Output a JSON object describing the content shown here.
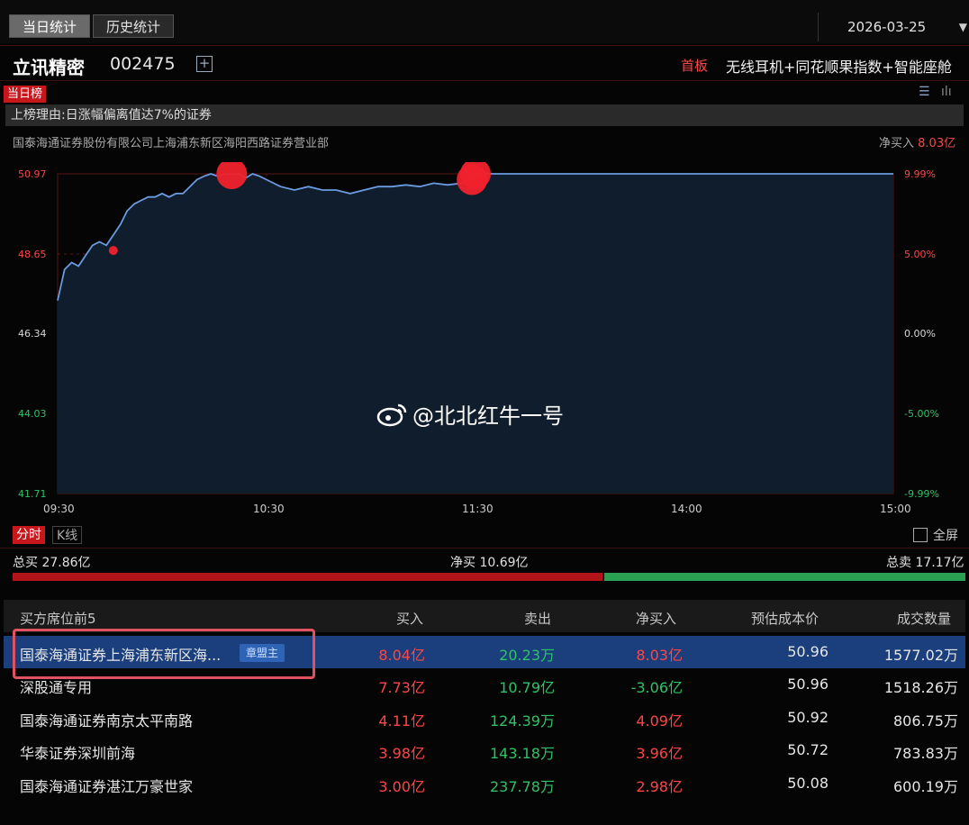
{
  "tabs": [
    {
      "label": "当日统计",
      "active": true
    },
    {
      "label": "历史统计",
      "active": false
    }
  ],
  "date": "2026-03-25",
  "stock": {
    "name": "立讯精密",
    "code": "002475",
    "add_symbol": "+",
    "board": "首板",
    "concepts": "无线耳机+同花顺果指数+智能座舱"
  },
  "list_badge": "当日榜",
  "reason": "上榜理由:日涨幅偏离值达7%的证券",
  "broker": "国泰海通证券股份有限公司上海浦东新区海阳西路证券营业部",
  "net_buy": {
    "label": "净买入",
    "value": "8.03亿"
  },
  "chart_data": {
    "type": "line",
    "title": "",
    "y_left_ticks": [
      "50.97",
      "48.65",
      "46.34",
      "44.03",
      "41.71"
    ],
    "y_right_ticks": [
      "9.99%",
      "5.00%",
      "0.00%",
      "-5.00%",
      "-9.99%"
    ],
    "x_ticks": [
      "09:30",
      "10:30",
      "11:30",
      "14:00",
      "15:00"
    ],
    "ylim": [
      41.71,
      50.97
    ],
    "pre_close": 46.34,
    "series": [
      {
        "x": [
          "09:30",
          "09:32",
          "09:34",
          "09:36",
          "09:38",
          "09:40",
          "09:42",
          "09:44",
          "09:46",
          "09:48",
          "09:50",
          "09:52",
          "09:54",
          "09:56",
          "09:58",
          "10:00",
          "10:02",
          "10:04",
          "10:06",
          "10:08",
          "10:10",
          "10:12",
          "10:14",
          "10:16",
          "10:18",
          "10:20",
          "10:22",
          "10:24",
          "10:26",
          "10:28",
          "10:30",
          "10:34",
          "10:38",
          "10:42",
          "10:46",
          "10:50",
          "10:54",
          "10:58",
          "11:02",
          "11:06",
          "11:10",
          "11:14",
          "11:18",
          "11:22",
          "11:26",
          "11:28",
          "11:30",
          "13:00",
          "13:30",
          "14:00",
          "14:30",
          "15:00"
        ],
        "values": [
          47.3,
          48.2,
          48.4,
          48.3,
          48.6,
          48.9,
          49.0,
          48.9,
          49.2,
          49.5,
          49.9,
          50.1,
          50.2,
          50.3,
          50.3,
          50.4,
          50.3,
          50.4,
          50.4,
          50.6,
          50.8,
          50.9,
          50.97,
          50.9,
          50.97,
          50.95,
          50.97,
          50.85,
          50.97,
          50.9,
          50.8,
          50.6,
          50.5,
          50.6,
          50.5,
          50.5,
          50.4,
          50.5,
          50.6,
          50.6,
          50.65,
          50.6,
          50.7,
          50.65,
          50.7,
          50.8,
          50.97,
          50.97,
          50.97,
          50.97,
          50.97,
          50.97
        ]
      }
    ],
    "markers": [
      {
        "time": "09:46",
        "value": 48.75,
        "size": "small"
      },
      {
        "time": "10:20",
        "value": 50.97,
        "size": "large"
      },
      {
        "time": "11:29",
        "value": 50.8,
        "size": "large"
      },
      {
        "time": "11:30",
        "value": 50.97,
        "size": "large"
      }
    ]
  },
  "chart_tabs": {
    "minute": "分时",
    "kline": "K线",
    "fullscreen": "全屏"
  },
  "totals": {
    "buy": "总买 27.86亿",
    "net": "净买 10.69亿",
    "sell": "总卖 17.17亿",
    "buy_ratio": 0.619
  },
  "table": {
    "headers": [
      "买方席位前5",
      "买入",
      "卖出",
      "净买入",
      "预估成本价",
      "成交数量"
    ],
    "rows": [
      {
        "name": "国泰海通证券上海浦东新区海...",
        "tag": "章盟主",
        "buy": "8.04亿",
        "sell": "20.23万",
        "net": "8.03亿",
        "net_color": "red",
        "cost": "50.96",
        "qty": "1577.02万",
        "selected": true
      },
      {
        "name": "深股通专用",
        "tag": "",
        "buy": "7.73亿",
        "sell": "10.79亿",
        "net": "-3.06亿",
        "net_color": "green",
        "cost": "50.96",
        "qty": "1518.26万",
        "selected": false
      },
      {
        "name": "国泰海通证券南京太平南路",
        "tag": "",
        "buy": "4.11亿",
        "sell": "124.39万",
        "net": "4.09亿",
        "net_color": "red",
        "cost": "50.92",
        "qty": "806.75万",
        "selected": false
      },
      {
        "name": "华泰证券深圳前海",
        "tag": "",
        "buy": "3.98亿",
        "sell": "143.18万",
        "net": "3.96亿",
        "net_color": "red",
        "cost": "50.72",
        "qty": "783.83万",
        "selected": false
      },
      {
        "name": "国泰海通证券湛江万豪世家",
        "tag": "",
        "buy": "3.00亿",
        "sell": "237.78万",
        "net": "2.98亿",
        "net_color": "red",
        "cost": "50.08",
        "qty": "600.19万",
        "selected": false
      }
    ]
  },
  "watermark": "@北北红牛一号",
  "colors": {
    "up": "#ff4545",
    "down": "#2fc266",
    "line": "#6a9be0",
    "selected_row": "#1a3f7c"
  }
}
